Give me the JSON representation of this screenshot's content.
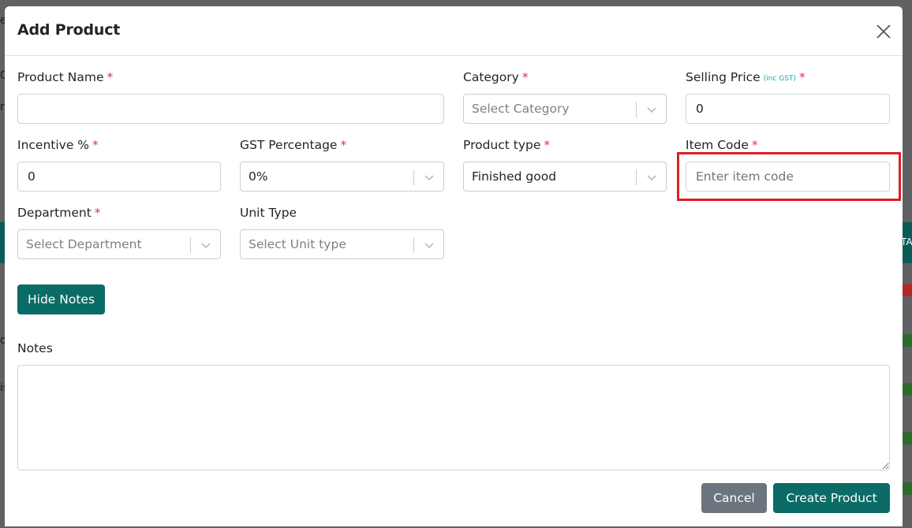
{
  "background": {
    "fragments": [
      "e",
      "C",
      "ro",
      "o",
      "is",
      "TA"
    ]
  },
  "modal": {
    "title": "Add Product",
    "close_icon": "close-icon"
  },
  "fields": {
    "product_name": {
      "label": "Product Name",
      "required": "*",
      "value": ""
    },
    "category": {
      "label": "Category",
      "required": "*",
      "value": "Select Category"
    },
    "selling_price": {
      "label": "Selling Price",
      "note": "(inc GST)",
      "required": "*",
      "value": "0"
    },
    "incentive": {
      "label": "Incentive %",
      "required": "*",
      "value": "0"
    },
    "gst_percentage": {
      "label": "GST Percentage",
      "required": "*",
      "value": "0%"
    },
    "product_type": {
      "label": "Product type",
      "required": "*",
      "value": "Finished good"
    },
    "item_code": {
      "label": "Item Code",
      "required": "*",
      "value": "",
      "placeholder": "Enter item code"
    },
    "department": {
      "label": "Department",
      "required": "*",
      "value": "Select Department"
    },
    "unit_type": {
      "label": "Unit Type",
      "value": "Select Unit type"
    },
    "notes": {
      "label": "Notes",
      "value": ""
    }
  },
  "buttons": {
    "hide_notes": "Hide Notes",
    "cancel": "Cancel",
    "create": "Create Product"
  },
  "colors": {
    "primary": "#0b6b66",
    "secondary": "#6c757d",
    "required": "#dc3545",
    "highlight": "#dc1f26"
  }
}
